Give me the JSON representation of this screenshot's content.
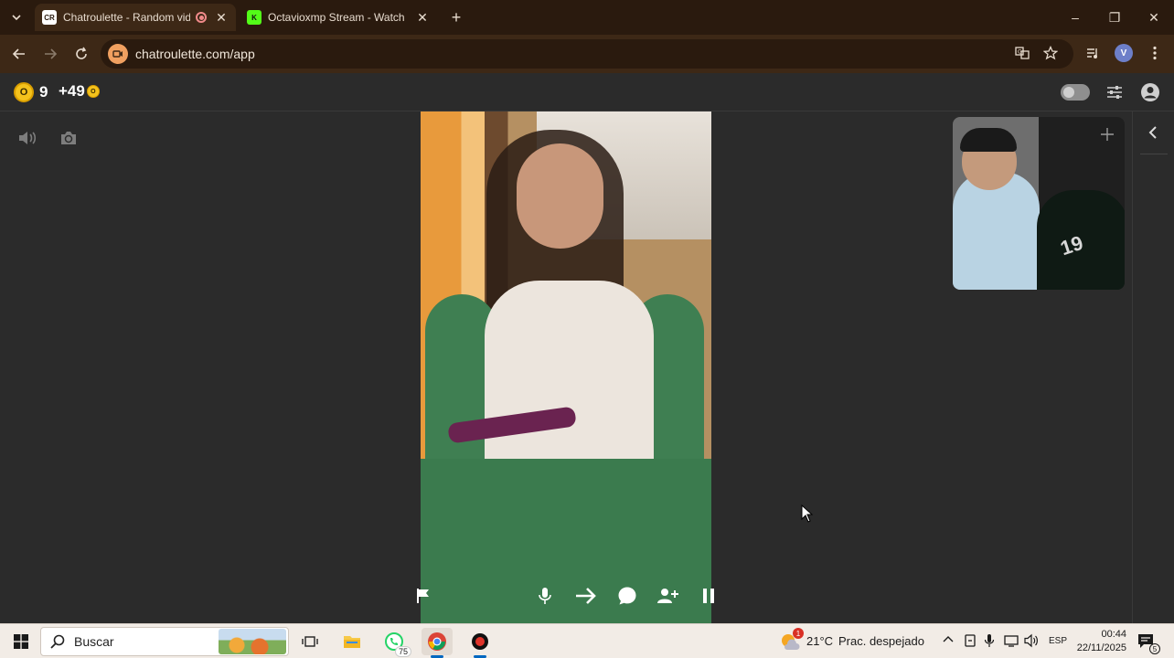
{
  "browser": {
    "tabs": [
      {
        "title": "Chatroulette - Random vide",
        "favicon_text": "CR",
        "recording": true,
        "active": true
      },
      {
        "title": "Octavioxmp Stream - Watch Li",
        "favicon_text": "K",
        "active": false
      }
    ],
    "new_tab_label": "+",
    "url": "chatroulette.com/app",
    "window_controls": {
      "minimize": "–",
      "maximize": "❐",
      "close": "✕"
    }
  },
  "app": {
    "coins": "9",
    "bonus": "+49",
    "coin_glyph": "O"
  },
  "pip": {
    "jersey_number": "19"
  },
  "taskbar": {
    "search_label": "Buscar",
    "whatsapp_badge": "75",
    "weather_badge": "1",
    "temperature": "21°C",
    "weather": "Prac. despejado",
    "language": "ESP",
    "time": "00:44",
    "date": "22/11/2025",
    "notification_count": "5"
  },
  "colors": {
    "tabstrip": "#2a1a0e",
    "toolbar": "#3d2816",
    "app_bg": "#2b2b2b",
    "coin": "#f4c21c",
    "taskbar": "#f2ece6"
  }
}
